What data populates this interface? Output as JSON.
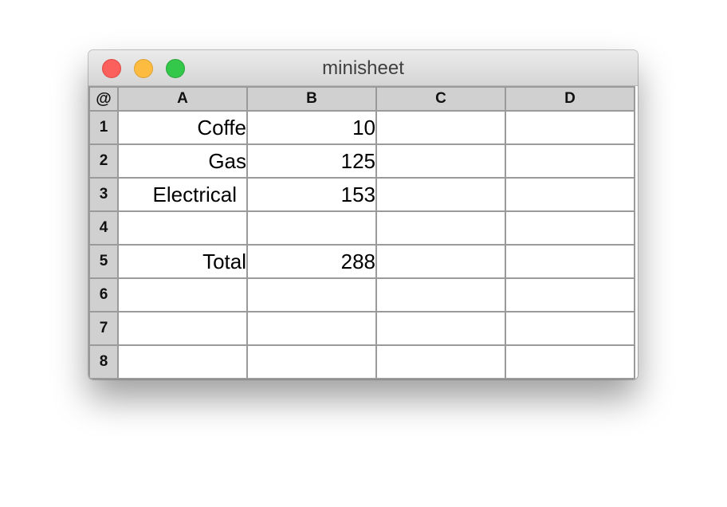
{
  "window": {
    "title": "minisheet"
  },
  "grid": {
    "corner": "@",
    "columns": [
      "A",
      "B",
      "C",
      "D"
    ],
    "rows": [
      {
        "label": "1",
        "cells": [
          "Coffe",
          "10",
          "",
          ""
        ]
      },
      {
        "label": "2",
        "cells": [
          "Gas",
          "125",
          "",
          ""
        ]
      },
      {
        "label": "3",
        "cells": [
          "Electrical ",
          "153",
          "",
          ""
        ]
      },
      {
        "label": "4",
        "cells": [
          "",
          "",
          "",
          ""
        ]
      },
      {
        "label": "5",
        "cells": [
          "Total",
          "288",
          "",
          ""
        ]
      },
      {
        "label": "6",
        "cells": [
          "",
          "",
          "",
          ""
        ]
      },
      {
        "label": "7",
        "cells": [
          "",
          "",
          "",
          ""
        ]
      },
      {
        "label": "8",
        "cells": [
          "",
          "",
          "",
          ""
        ]
      }
    ]
  },
  "colors": {
    "close": "#fc605c",
    "minimize": "#fdbc40",
    "zoom": "#34c84a",
    "header_bg": "#d0d0d0",
    "grid_line": "#9a9a9a"
  }
}
